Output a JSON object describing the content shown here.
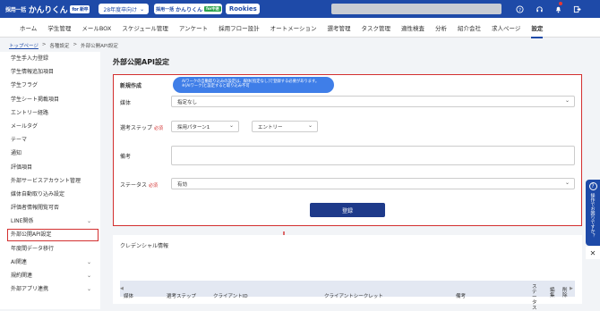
{
  "topbar": {
    "logo_small": "採用一括",
    "logo_main": "かんりくん",
    "logo_badge": "for 新卒",
    "grad_year": "28年度卒向け",
    "promo_small": "採用一括",
    "promo_main": "かんりくん",
    "promo_badge": "for中途",
    "rookies": "Rookies"
  },
  "nav": [
    "ホーム",
    "学生管理",
    "メールBOX",
    "スケジュール管理",
    "アンケート",
    "採用フロー設計",
    "オートメーション",
    "選考管理",
    "タスク管理",
    "適性検査",
    "分析",
    "紹介会社",
    "求人ページ",
    "設定"
  ],
  "breadcrumb": {
    "top": "トップページ",
    "sep": ">",
    "settings": "各種設定",
    "current": "外部公開API設定"
  },
  "sidebar": [
    {
      "label": "学生手入力登録"
    },
    {
      "label": "学生情報追加項目"
    },
    {
      "label": "学生フラグ"
    },
    {
      "label": "学生シート掲載項目"
    },
    {
      "label": "エントリー経路"
    },
    {
      "label": "メールタグ"
    },
    {
      "label": "テーマ"
    },
    {
      "label": "通知"
    },
    {
      "label": "評価項目"
    },
    {
      "label": "外部サービスアカウント管理"
    },
    {
      "label": "媒体自動取り込み設定"
    },
    {
      "label": "評価者情報閲覧可否"
    },
    {
      "label": "LINE関係"
    },
    {
      "label": "外部公開API設定"
    },
    {
      "label": "年度間データ移行"
    },
    {
      "label": "AI関連"
    },
    {
      "label": "規約関連"
    },
    {
      "label": "外部アプリ連携"
    }
  ],
  "page_title": "外部公開API設定",
  "form": {
    "new_label": "新規作成",
    "tip_line1": "AIワークの自動取り込みの設定は、媒体[指定なし]で登録する必要があります。",
    "tip_line2": "※[AIワーク]と設定すると取り込み不可",
    "media_label": "媒体",
    "media_value": "指定なし",
    "step_label": "選考ステップ",
    "required": "必須",
    "pattern_value": "採用パターン1",
    "entry_value": "エントリー",
    "note_label": "備考",
    "status_label": "ステータス",
    "status_value": "有効",
    "register": "登録"
  },
  "credentials": {
    "title": "クレデンシャル情報",
    "headers": [
      "媒体",
      "選考ステップ",
      "クライアントID",
      "クライアントシークレット",
      "備考",
      "ステータス",
      "編集",
      "削除"
    ]
  },
  "sidetab": {
    "label": "操作でお困りですか？"
  },
  "colors": {
    "brand": "#1e4aa8",
    "highlight": "#d32f2f",
    "button": "#1e3a8a"
  }
}
